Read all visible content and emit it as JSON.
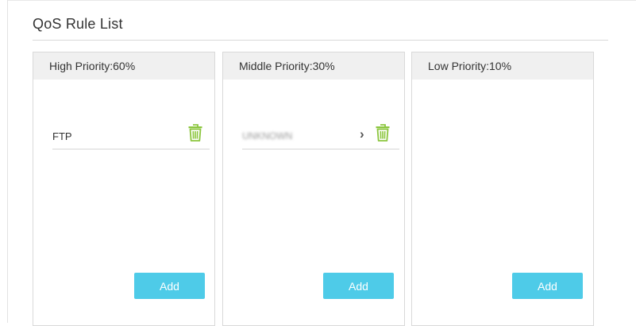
{
  "page": {
    "title": "QoS Rule List"
  },
  "panels": [
    {
      "header": "High Priority:60%",
      "rules": [
        {
          "name": "FTP"
        }
      ],
      "add_label": "Add"
    },
    {
      "header": "Middle Priority:30%",
      "rules": [
        {
          "name": "UNKNOWN"
        }
      ],
      "add_label": "Add"
    },
    {
      "header": "Low Priority:10%",
      "rules": [],
      "add_label": "Add"
    }
  ],
  "colors": {
    "accent": "#4ecbe8",
    "trash_icon": "#8cc63f",
    "header_bg": "#f0f0f0"
  },
  "icons": {
    "delete": "trash-icon",
    "expand": "chevron-right-icon"
  }
}
